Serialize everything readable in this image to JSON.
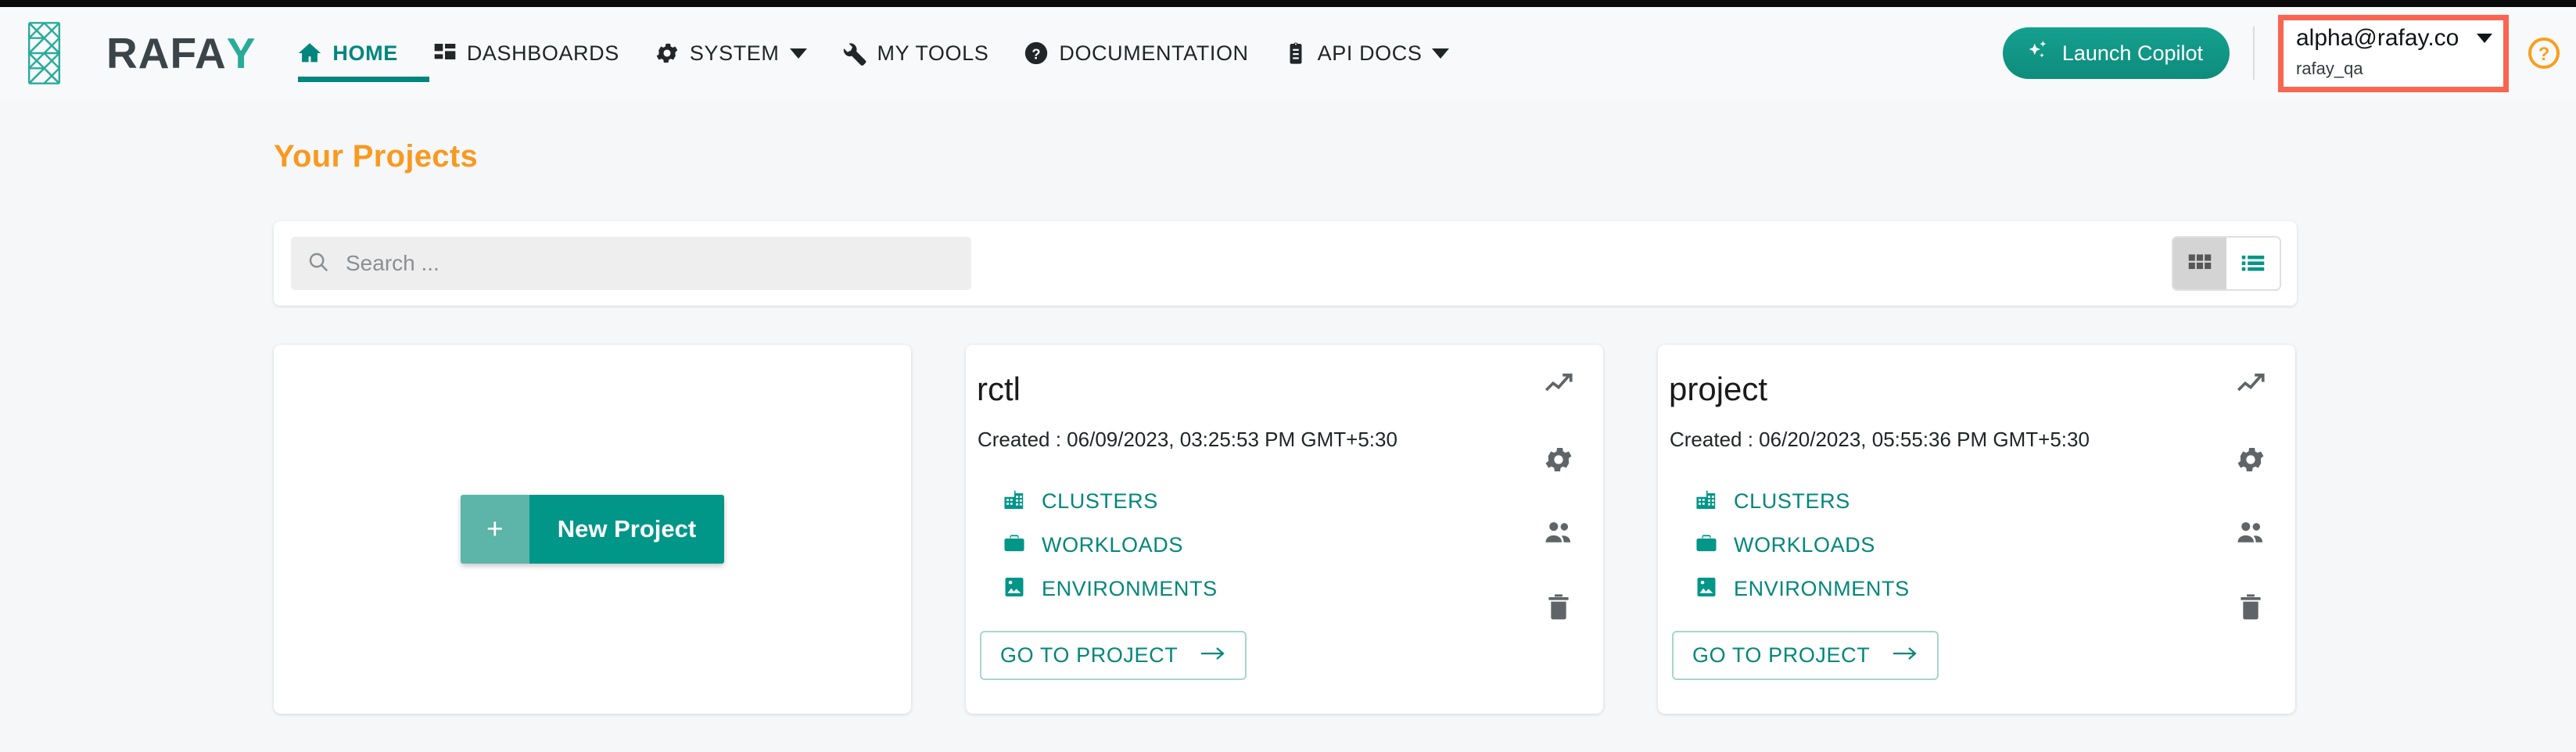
{
  "header": {
    "logo_text_main": "RAFA",
    "logo_text_accent": "Y",
    "nav_items": [
      {
        "label": "HOME",
        "icon": "home-icon",
        "active": true,
        "caret": false
      },
      {
        "label": "DASHBOARDS",
        "icon": "dashboards-icon",
        "active": false,
        "caret": false
      },
      {
        "label": "SYSTEM",
        "icon": "gear-icon",
        "active": false,
        "caret": true
      },
      {
        "label": "MY TOOLS",
        "icon": "wrench-icon",
        "active": false,
        "caret": false
      },
      {
        "label": "DOCUMENTATION",
        "icon": "question-circle-icon",
        "active": false,
        "caret": false
      },
      {
        "label": "API DOCS",
        "icon": "clipboard-icon",
        "active": false,
        "caret": true
      }
    ],
    "copilot_label": "Launch Copilot",
    "user_email": "alpha@rafay.co",
    "user_org": "rafay_qa",
    "help_icon": "help-circle-icon",
    "highlight_color": "#fa6450"
  },
  "main": {
    "page_title": "Your Projects",
    "search": {
      "placeholder": "Search ...",
      "value": "",
      "icon": "search-icon"
    },
    "view_toggle": {
      "grid_label": "grid-view",
      "list_label": "list-view",
      "selected": "grid"
    },
    "new_project": {
      "plus": "+",
      "label": "New Project"
    },
    "card_link_labels": {
      "clusters": "CLUSTERS",
      "workloads": "WORKLOADS",
      "environments": "ENVIRONMENTS"
    },
    "goto_label": "GO TO PROJECT",
    "projects": [
      {
        "name": "rctl",
        "created": "Created : 06/09/2023, 03:25:53 PM GMT+5:30"
      },
      {
        "name": "project",
        "created": "Created : 06/20/2023, 05:55:36 PM GMT+5:30"
      }
    ]
  },
  "colors": {
    "teal": "#009688",
    "teal_dark": "#00877a",
    "orange": "#f89a20",
    "page_bg": "#f5f7f9"
  }
}
